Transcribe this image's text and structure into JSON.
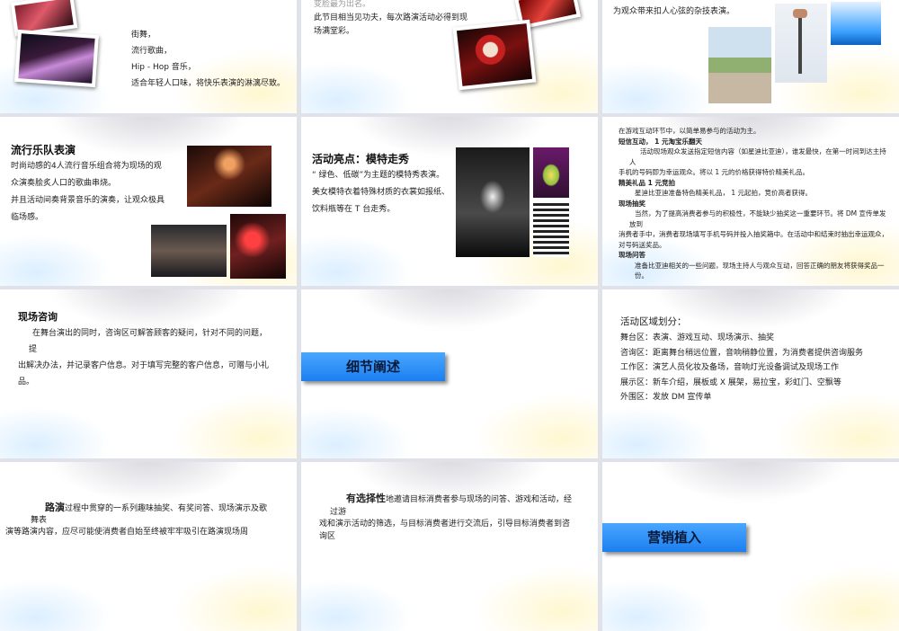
{
  "slides": {
    "s1": {
      "lines": [
        "街舞，",
        "流行歌曲，",
        "Hip - Hop 音乐，",
        "适合年轻人口味，将快乐表演的淋漓尽致。"
      ]
    },
    "s2": {
      "lines": [
        "变脸最为出名。",
        "此节目相当见功夫，每次路演活动必得到现",
        "场满堂彩。"
      ]
    },
    "s3": {
      "text": "为观众带来扣人心弦的杂技表演。"
    },
    "s4": {
      "title": "流行乐队表演",
      "lines": [
        "时尚动感的4人流行音乐组合将为现场的观",
        "众演奏脍炙人口的歌曲串烧。",
        "并且活动间奏背景音乐的演奏，让观众极具",
        "临场感。"
      ]
    },
    "s5": {
      "title": "活动亮点：模特走秀",
      "lines": [
        "“ 绿色、低碳”为主题的模特秀表演。",
        "美女模特衣着特殊材质的衣裳如报纸、",
        "饮料瓶等在 T 台走秀。"
      ]
    },
    "s6": {
      "lines": [
        "在游戏互动环节中，以简单易参与的活动为主。",
        "短信互动， 1 元淘宝乐翻天",
        "活动现场观众发送指定短信内容（如星迪比亚迪），谁发最快，在第一时间到达主持",
        "人",
        "手机的号码即为幸运观众。将以 1 元的价格获得特价精美礼品。",
        "精美礼品 1 元竞拍",
        "星迪比亚迪准备特色精美礼品， 1 元起拍，竞价高者获得。",
        "现场抽奖",
        "当然，为了提高消费者参与的积极性，不能缺少抽奖这一重要环节。将 DM 宣传单发",
        "放到",
        "消费者手中，消费者现场填写手机号码并投入抽奖箱中。在活动中和结束时抽出幸运观众，",
        "对号码送奖品。",
        "现场问答",
        "准备比亚迪相关的一些问题，现场主持人与观众互动，回答正确的朋友将获得奖品一份。"
      ]
    },
    "s7": {
      "title": "现场咨询",
      "lines": [
        "在舞台演出的同时，咨询区可解答顾客的疑问，针对不同的问题，",
        "提",
        "出解决办法，并记录客户信息。对于填写完整的客户信息，可赠与小礼",
        "品。"
      ]
    },
    "s8": {
      "button": "细节阐述"
    },
    "s9": {
      "title": "活动区域划分：",
      "lines": [
        "舞台区：表演、游戏互动、现场演示、抽奖",
        "咨询区：距离舞台稍远位置，音响稍静位置，为消费者提供咨询服务",
        "工作区：演艺人员化妆及备场，音响灯光设备调试及现场工作",
        "展示区：新车介绍，展板或 X 展架，易拉宝，彩虹门、空飘等",
        "外围区：发放 DM 宣传单"
      ]
    },
    "s10": {
      "bold": "路演",
      "rest": "过程中贯穿的一系列趣味抽奖、有奖问答、现场演示及歌",
      "lines": [
        "舞表",
        "演等路演内容，应尽可能使消费者自始至终被牢牢吸引在路演现场周"
      ]
    },
    "s11": {
      "bold": "有选择性",
      "rest": "地邀请目标消费者参与现场的问答、游戏和活动，经",
      "lines": [
        "过游",
        "戏和演示活动的筛选，与目标消费者进行交流后，引导目标消费者到咨",
        "询区"
      ]
    },
    "s12": {
      "button": "营销植入"
    }
  },
  "colors": {
    "accent_blue": "#2b8cf7",
    "text": "#222222"
  }
}
